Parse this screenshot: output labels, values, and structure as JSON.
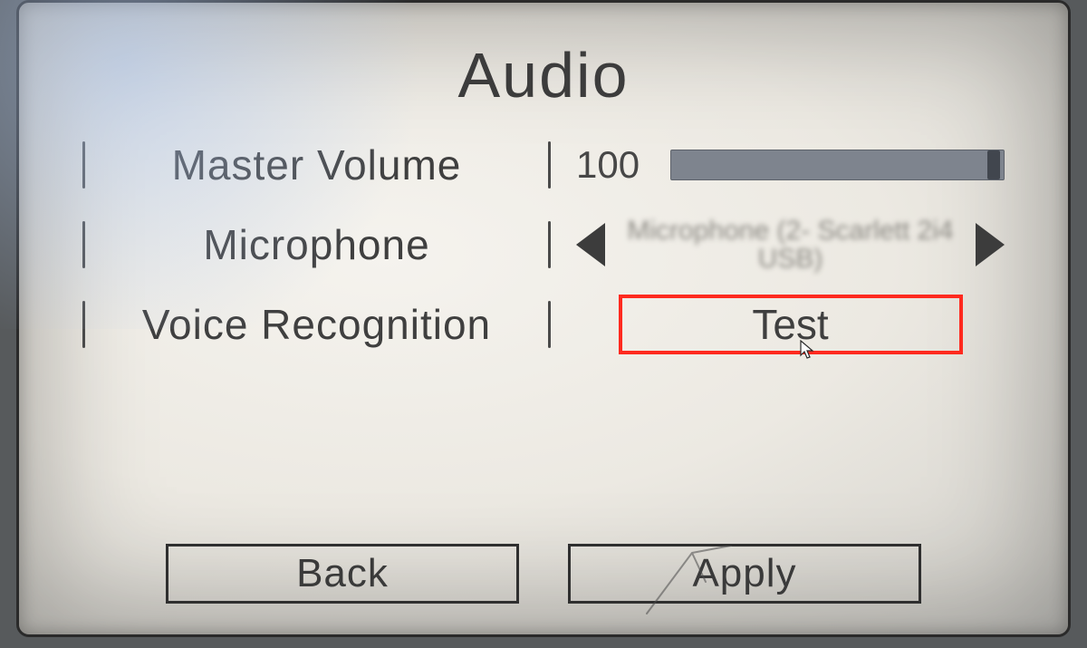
{
  "title": "Audio",
  "settings": {
    "master_volume": {
      "label": "Master Volume",
      "value": "100"
    },
    "microphone": {
      "label": "Microphone",
      "device": "Microphone (2- Scarlett 2i4 USB)"
    },
    "voice_recog": {
      "label": "Voice Recognition",
      "button": "Test"
    }
  },
  "buttons": {
    "back": "Back",
    "apply": "Apply"
  }
}
